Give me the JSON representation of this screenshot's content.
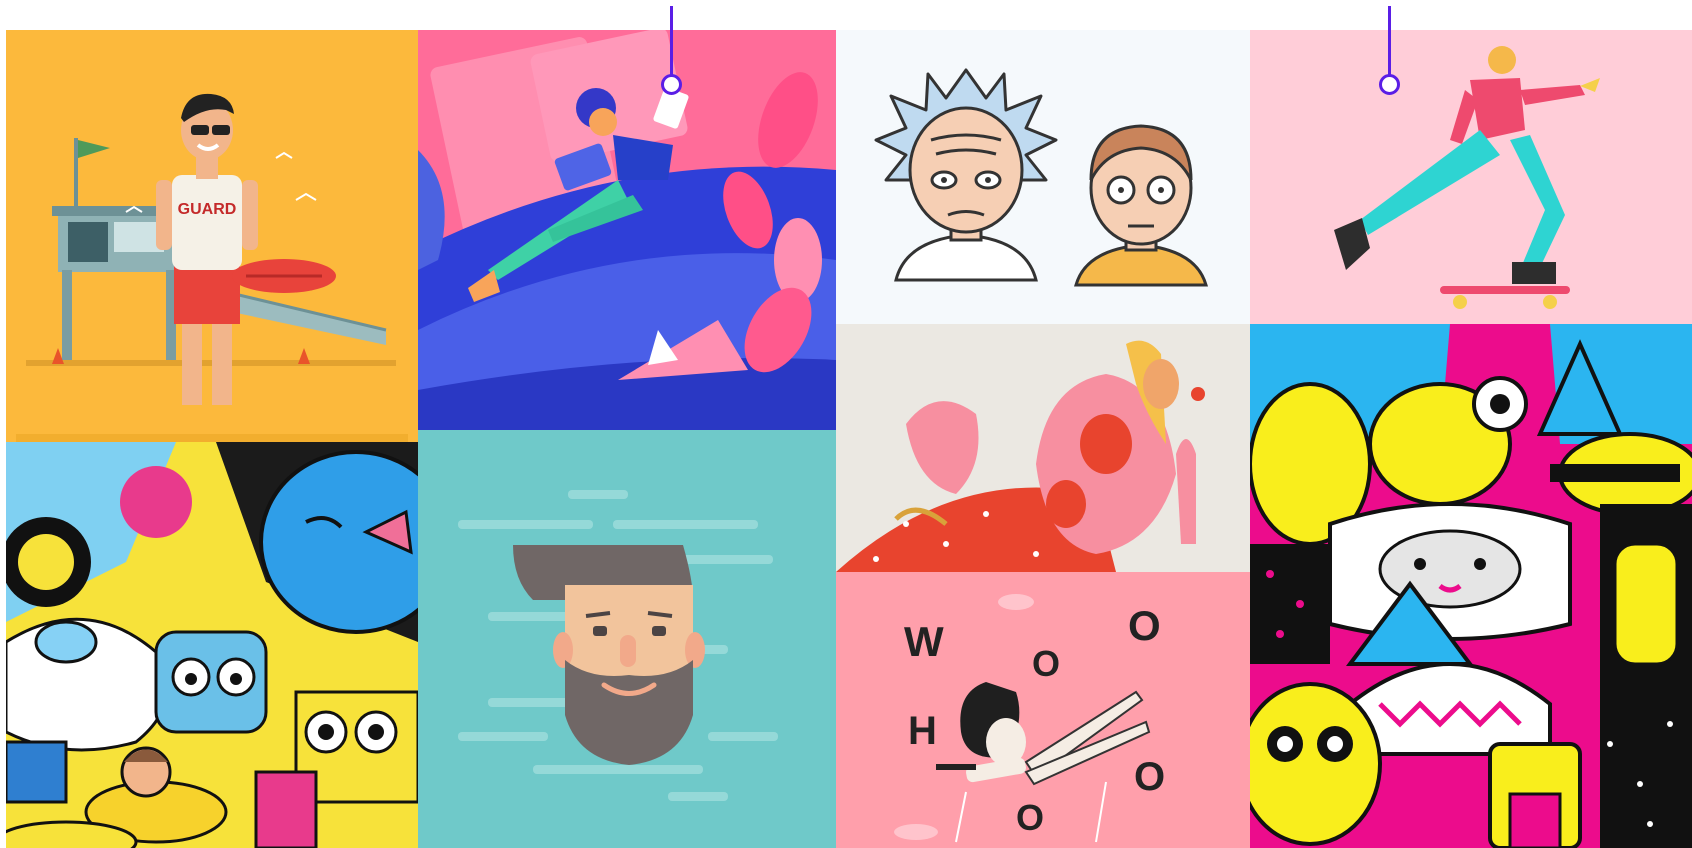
{
  "gallery": {
    "tiles": [
      {
        "id": "lifeguard",
        "bg": "#fcb93c",
        "shirt_text": "GUARD"
      },
      {
        "id": "office-wave",
        "bg": "#ff6c99"
      },
      {
        "id": "rick-morty",
        "bg": "#f5f9fc"
      },
      {
        "id": "skater",
        "bg": "#ffcdd8"
      },
      {
        "id": "cartoon-collage",
        "bg": "#f7e23a"
      },
      {
        "id": "beard-face",
        "bg": "#6fc9c9"
      },
      {
        "id": "pink-figure",
        "bg": "#ebe8e2"
      },
      {
        "id": "whooo-fall",
        "bg": "#ff9fab",
        "letters": [
          "W",
          "O",
          "O",
          "H",
          "O",
          "O"
        ]
      },
      {
        "id": "monster-collage",
        "bg": "#ec0c8c"
      }
    ],
    "accent": "#5a1ee6"
  }
}
